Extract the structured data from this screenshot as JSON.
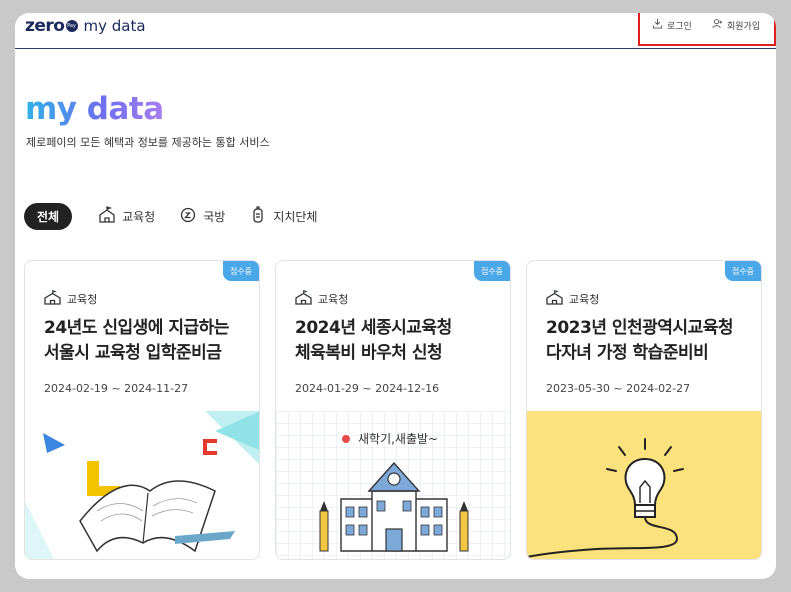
{
  "header": {
    "logo": {
      "zero": "zero",
      "badge": "Pay",
      "my": "my data"
    },
    "login_label": "로그인",
    "signup_label": "회원가입"
  },
  "hero": {
    "title": "my data",
    "subtitle": "제로페이의 모든 혜택과 정보를 제공하는 통합 서비스"
  },
  "filters": [
    {
      "label": "전체",
      "icon": "none",
      "active": true
    },
    {
      "label": "교육청",
      "icon": "school-icon",
      "active": false
    },
    {
      "label": "국방",
      "icon": "military-icon",
      "active": false
    },
    {
      "label": "지치단체",
      "icon": "building-icon",
      "active": false
    }
  ],
  "cards": [
    {
      "badge": "접수중",
      "category": "교육청",
      "title_line1": "24년도 신입생에 지급하는",
      "title_line2": "서울시 교육청 입학준비금",
      "period": "2024-02-19 ~ 2024-11-27",
      "image_icon": "open-book-illustration"
    },
    {
      "badge": "접수중",
      "category": "교육청",
      "title_line1": "2024년 세종시교육청",
      "title_line2": "체육복비 바우처 신청",
      "period": "2024-01-29 ~ 2024-12-16",
      "image_icon": "school-building-illustration",
      "image_caption": "새학기,새출발~"
    },
    {
      "badge": "접수중",
      "category": "교육청",
      "title_line1": "2023년 인천광역시교육청",
      "title_line2": "다자녀 가정 학습준비비",
      "period": "2023-05-30 ~ 2024-02-27",
      "image_icon": "light-bulb-illustration"
    }
  ],
  "colors": {
    "accent": "#4aa7e8",
    "navy": "#1b2a5c",
    "highlight_box": "#e02020"
  }
}
